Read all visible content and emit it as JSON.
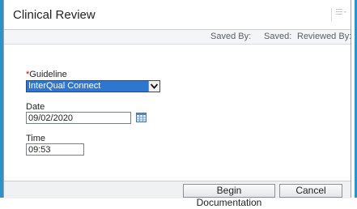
{
  "dialog": {
    "title": "Clinical Review",
    "menu_icon": "hamburger-menu-icon"
  },
  "status": {
    "saved_by": "Saved By:",
    "saved": "Saved:",
    "reviewed_by": "Reviewed By:"
  },
  "form": {
    "guideline": {
      "required_marker": "*",
      "label": "Guideline",
      "value": "InterQual Connect"
    },
    "date": {
      "label": "Date",
      "value": "09/02/2020"
    },
    "time": {
      "label": "Time",
      "value": "09:53"
    }
  },
  "actions": {
    "begin_documentation": "Begin Documentation",
    "cancel": "Cancel"
  },
  "colors": {
    "accent_border": "#2a93c9",
    "selected_highlight": "#2d77d0",
    "required": "#d40000"
  }
}
